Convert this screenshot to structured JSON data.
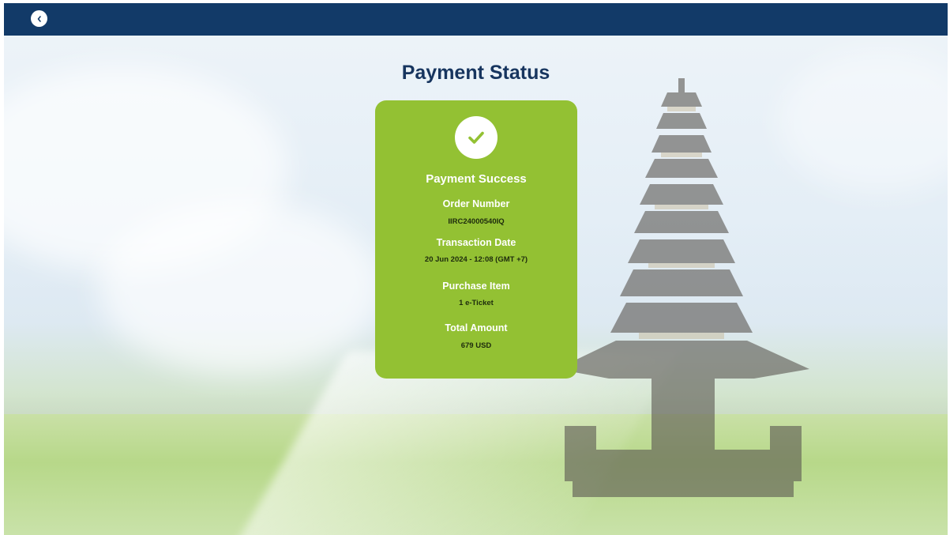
{
  "topbar": {
    "back_icon": "chevron-left-icon"
  },
  "page": {
    "title": "Payment Status"
  },
  "card": {
    "icon": "check-icon",
    "status": "Payment Success",
    "order_number_label": "Order Number",
    "order_number_value": "IIRC24000540IQ",
    "transaction_date_label": "Transaction Date",
    "transaction_date_value": "20 Jun 2024 - 12:08 (GMT +7)",
    "purchase_item_label": "Purchase Item",
    "purchase_item_value": "1 e-Ticket",
    "total_amount_label": "Total Amount",
    "total_amount_value": "679 USD"
  },
  "colors": {
    "topbar": "#123a68",
    "title": "#17355f",
    "card_background": "#93c133",
    "value_text": "#1d2b0d"
  }
}
